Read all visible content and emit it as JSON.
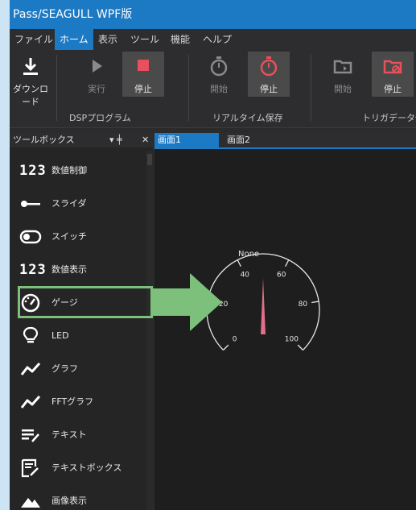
{
  "title": "Pass/SEAGULL WPF版",
  "menu": [
    "ファイル",
    "ホーム",
    "表示",
    "ツール",
    "機能",
    "ヘルプ"
  ],
  "ribbon": {
    "download": "ダウンロード",
    "dsp_run": "実行",
    "dsp_stop": "停止",
    "dsp_group": "DSPプログラム",
    "rt_start": "開始",
    "rt_stop": "停止",
    "rt_group": "リアルタイム保存",
    "trig_start": "開始",
    "trig_stop": "停止",
    "trig_group": "トリガデータ保"
  },
  "colors": {
    "accent": "#1c79c4",
    "stop_red": "#e8505b",
    "highlight_green": "#7cc07c",
    "needle": "#e0708a"
  },
  "toolbox": {
    "title": "ツールボックス",
    "pin_glyph": "▾ ╪",
    "close_glyph": "✕",
    "items": [
      {
        "label": "数値制御",
        "icon": "numeric-icon",
        "glyph": "123"
      },
      {
        "label": "スライダ",
        "icon": "slider-icon"
      },
      {
        "label": "スイッチ",
        "icon": "toggle-switch-icon"
      },
      {
        "label": "数値表示",
        "icon": "numeric-icon",
        "glyph": "123"
      },
      {
        "label": "ゲージ",
        "icon": "gauge-icon"
      },
      {
        "label": "LED",
        "icon": "lightbulb-icon"
      },
      {
        "label": "グラフ",
        "icon": "graph-icon"
      },
      {
        "label": "FFTグラフ",
        "icon": "fft-graph-icon"
      },
      {
        "label": "テキスト",
        "icon": "text-icon"
      },
      {
        "label": "テキストボックス",
        "icon": "textbox-icon"
      },
      {
        "label": "画像表示",
        "icon": "image-icon"
      }
    ]
  },
  "tabs": [
    "画面1",
    "画面2"
  ],
  "gauge": {
    "label": "None",
    "ticks": [
      "0",
      "20",
      "40",
      "60",
      "80",
      "100"
    ],
    "min": 0,
    "max": 100,
    "value": 50
  }
}
